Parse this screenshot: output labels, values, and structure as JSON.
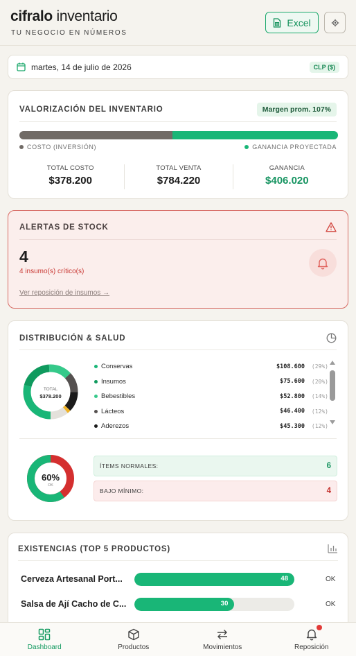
{
  "header": {
    "brand_bold": "cifralo",
    "brand_light": "inventario",
    "tagline": "TU NEGOCIO EN NÚMEROS",
    "excel_label": "Excel"
  },
  "datebar": {
    "date": "martes, 14 de julio de 2026",
    "currency": "CLP ($)"
  },
  "valorizacion": {
    "title": "VALORIZACIÓN DEL INVENTARIO",
    "margin_badge": "Margen prom. 107%",
    "cost_fraction": 0.48,
    "legend_cost": "COSTO (INVERSIÓN)",
    "legend_gain": "GANANCIA PROYECTADA",
    "totals": [
      {
        "label": "TOTAL COSTO",
        "value": "$378.200"
      },
      {
        "label": "TOTAL VENTA",
        "value": "$784.220"
      },
      {
        "label": "GANANCIA",
        "value": "$406.020"
      }
    ],
    "colors": {
      "cost": "#716b66",
      "gain": "#19b677"
    }
  },
  "alertas": {
    "title": "ALERTAS DE STOCK",
    "count": "4",
    "subtitle": "4 insumo(s) crítico(s)",
    "link": "Ver reposición de insumos →"
  },
  "distribucion": {
    "title": "DISTRIBUCIÓN & SALUD",
    "total_label": "TOTAL",
    "total_value": "$378.200",
    "categories": [
      {
        "name": "Conservas",
        "amount": "$108.600",
        "pct": "(29%)",
        "share": 29,
        "color": "#19b677"
      },
      {
        "name": "Insumos",
        "amount": "$75.600",
        "pct": "(20%)",
        "share": 20,
        "color": "#0f9a5e"
      },
      {
        "name": "Bebestibles",
        "amount": "$52.800",
        "pct": "(14%)",
        "share": 14,
        "color": "#35c98a"
      },
      {
        "name": "Lácteos",
        "amount": "$46.400",
        "pct": "(12%)",
        "share": 12,
        "color": "#555150"
      },
      {
        "name": "Aderezos",
        "amount": "$45.300",
        "pct": "(12%)",
        "share": 12,
        "color": "#1b1b1b"
      }
    ],
    "health_pct": "60%",
    "health_label": "OK",
    "health_fraction": 0.6,
    "normal_label": "ÍTEMS NORMALES:",
    "normal_value": "6",
    "bajo_label": "BAJO MÍNIMO:",
    "bajo_value": "4"
  },
  "existencias": {
    "title": "EXISTENCIAS (TOP 5 PRODUCTOS)",
    "products": [
      {
        "name": "Cerveza Artesanal Port...",
        "qty": "48",
        "fraction": 1.0,
        "status": "OK"
      },
      {
        "name": "Salsa de Ají Cacho de C...",
        "qty": "30",
        "fraction": 0.625,
        "status": "OK"
      }
    ]
  },
  "nav": {
    "items": [
      {
        "label": "Dashboard"
      },
      {
        "label": "Productos"
      },
      {
        "label": "Movimientos"
      },
      {
        "label": "Reposición"
      }
    ]
  }
}
